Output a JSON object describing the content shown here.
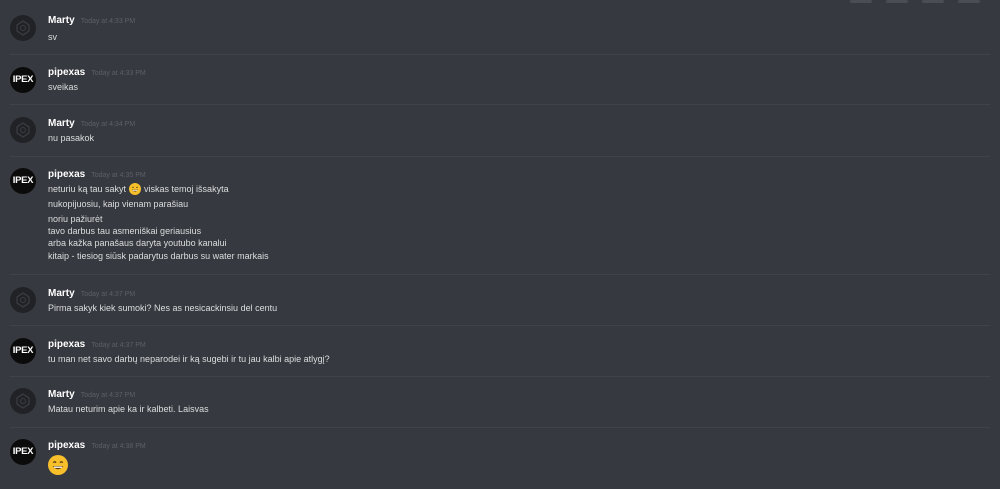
{
  "messages": [
    {
      "author": "Marty",
      "timestamp": "Today at 4:33 PM",
      "lines": [
        "sv"
      ]
    },
    {
      "author": "pipexas",
      "timestamp": "Today at 4:33 PM",
      "lines": [
        "sveikas"
      ]
    },
    {
      "author": "Marty",
      "timestamp": "Today at 4:34 PM",
      "lines": [
        "nu pasakok"
      ]
    },
    {
      "author": "pipexas",
      "timestamp": "Today at 4:35 PM",
      "line1_before": "neturiu ką tau sakyt",
      "line1_emoji": "grinning-emoji",
      "line1_after": "viskas temoj išsakyta",
      "lines": [
        "nukopijuosiu, kaip vienam parašiau",
        "noriu pažiurėt",
        "tavo darbus tau asmeniškai geriausius",
        "arba kažka panašaus daryta youtubo kanalui",
        "kitaip - tiesiog siūsk padarytus darbus su water markais"
      ]
    },
    {
      "author": "Marty",
      "timestamp": "Today at 4:37 PM",
      "lines": [
        "Pirma sakyk kiek sumoki? Nes as nesicackinsiu del centu"
      ]
    },
    {
      "author": "pipexas",
      "timestamp": "Today at 4:37 PM",
      "lines": [
        "tu man net savo darbų neparodei ir ką sugebi ir tu jau kalbi apie atlygį?"
      ]
    },
    {
      "author": "Marty",
      "timestamp": "Today at 4:37 PM",
      "lines": [
        "Matau neturim apie ka ir kalbeti. Laisvas"
      ]
    },
    {
      "author": "pipexas",
      "timestamp": "Today at 4:38 PM",
      "emoji_only": "grinning-emoji"
    }
  ],
  "avatars": {
    "pipexas_logo_text": "IPEX"
  },
  "colors": {
    "background": "#36393f",
    "username": "#ffffff",
    "timestamp": "#5d6067",
    "text": "#dcddde",
    "emoji": "#f7c02a"
  }
}
